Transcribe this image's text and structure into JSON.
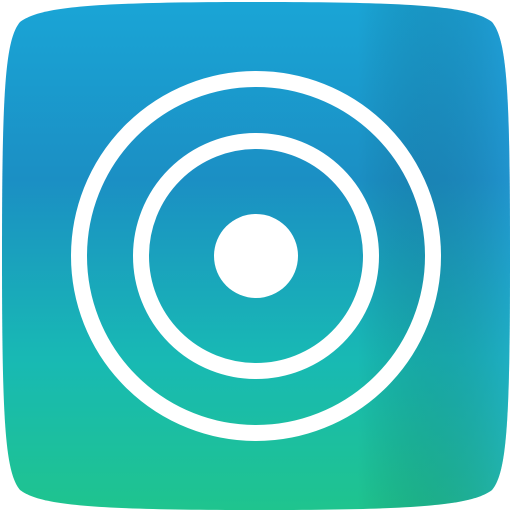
{
  "icon": {
    "name": "target-icon",
    "gradient_colors": [
      "#1aa5d6",
      "#1b8fc4",
      "#18b9b4",
      "#1fc48e"
    ],
    "glyph_color": "#ffffff"
  }
}
